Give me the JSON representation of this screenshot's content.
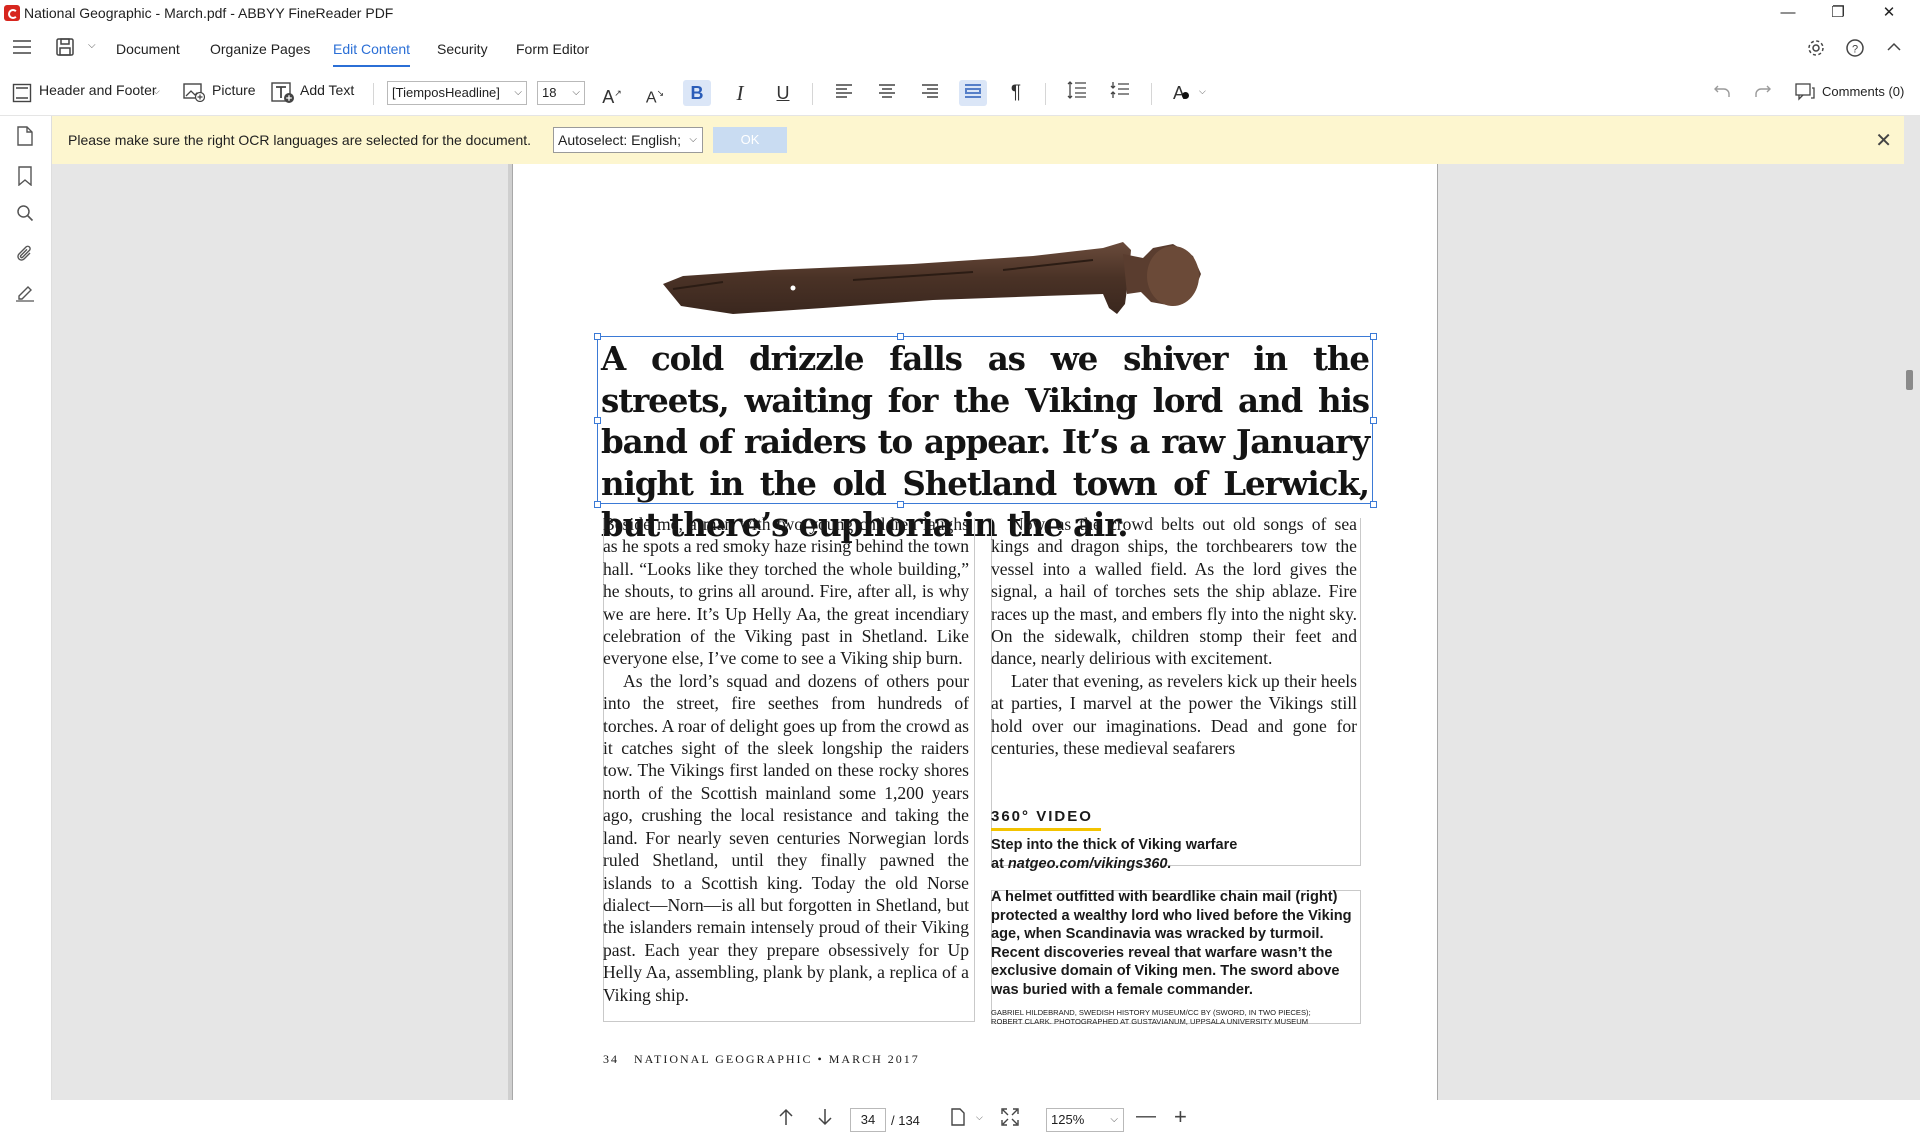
{
  "window": {
    "title": "National Geographic - March.pdf - ABBYY FineReader PDF",
    "minimize": "—",
    "restore": "❐",
    "close": "✕"
  },
  "menu": {
    "tabs": [
      "Document",
      "Organize Pages",
      "Edit Content",
      "Security",
      "Form Editor"
    ],
    "active_tab": "Edit Content"
  },
  "toolbar": {
    "header_footer": "Header and Footer",
    "picture": "Picture",
    "add_text": "Add Text",
    "font_family": "[TiemposHeadline]",
    "font_size": "18",
    "comments": "Comments (0)"
  },
  "notification": {
    "message": "Please make sure the right OCR languages are selected for the document.",
    "language_select": "Autoselect: English;",
    "ok_label": "OK"
  },
  "document": {
    "headline": "A cold drizzle falls as we shiver in the streets, waiting for the Viking lord and his band of raiders to appear. It’s a raw January night in the old Shetland town of Lerwick, but there’s euphoria in the air.",
    "col1_p1": "Beside me, a man with two young children laughs as he spots a red smoky haze rising behind the town hall. “Looks like they torched the whole building,” he shouts, to grins all around. Fire, after all, is why we are here. It’s Up Helly Aa, the great incendiary celebration of the Viking past in Shetland. Like everyone else, I’ve come to see a Viking ship burn.",
    "col1_p2": "As the lord’s squad and dozens of others pour into the street, fire seethes from hundreds of torches. A roar of delight goes up from the crowd as it catches sight of the sleek longship the raiders tow. The Vikings first landed on these rocky shores north of the Scottish mainland some 1,200 years ago, crushing the local resistance and taking the land. For nearly seven centuries Norwegian lords ruled Shetland, until they finally pawned the islands to a Scottish king. Today the old Norse dialect—Norn—is all but forgotten in Shetland, but the islanders remain intensely proud of their Viking past. Each year they prepare obsessively for Up Helly Aa, assembling, plank by plank, a replica of a Viking ship.",
    "col2_p1": "Now, as the crowd belts out old songs of sea kings and dragon ships, the torchbearers tow the vessel into a walled field. As the lord gives the signal, a hail of torches sets the ship ablaze. Fire races up the mast, and embers fly into the night sky. On the sidewalk, children stomp their feet and dance, nearly delirious with excitement.",
    "col2_p2": "Later that evening, as revelers kick up their heels at parties, I marvel at the power the Vikings still hold over our imaginations. Dead and gone for centuries, these medieval seafarers",
    "video_heading": "360° VIDEO",
    "video_text_1": "Step into the thick of Viking warfare",
    "video_text_2": "at ",
    "video_url": "natgeo.com/vikings360.",
    "caption": "A helmet outfitted with beardlike chain mail (right) protected a wealthy lord who lived before the Viking age, when Scandinavia was wracked by turmoil. Recent discoveries reveal that warfare wasn’t the exclusive domain of Viking men. The sword above was buried with a female commander.",
    "credit_1": "GABRIEL HILDEBRAND, SWEDISH HISTORY MUSEUM/CC BY (SWORD, IN TWO PIECES);",
    "credit_2": "ROBERT CLARK. PHOTOGRAPHED AT GUSTAVIANUM, UPPSALA UNIVERSITY MUSEUM",
    "folio": "34   NATIONAL GEOGRAPHIC • MARCH 2017"
  },
  "navigation": {
    "current_page": "34",
    "total_pages": "/ 134",
    "zoom": "125%"
  }
}
